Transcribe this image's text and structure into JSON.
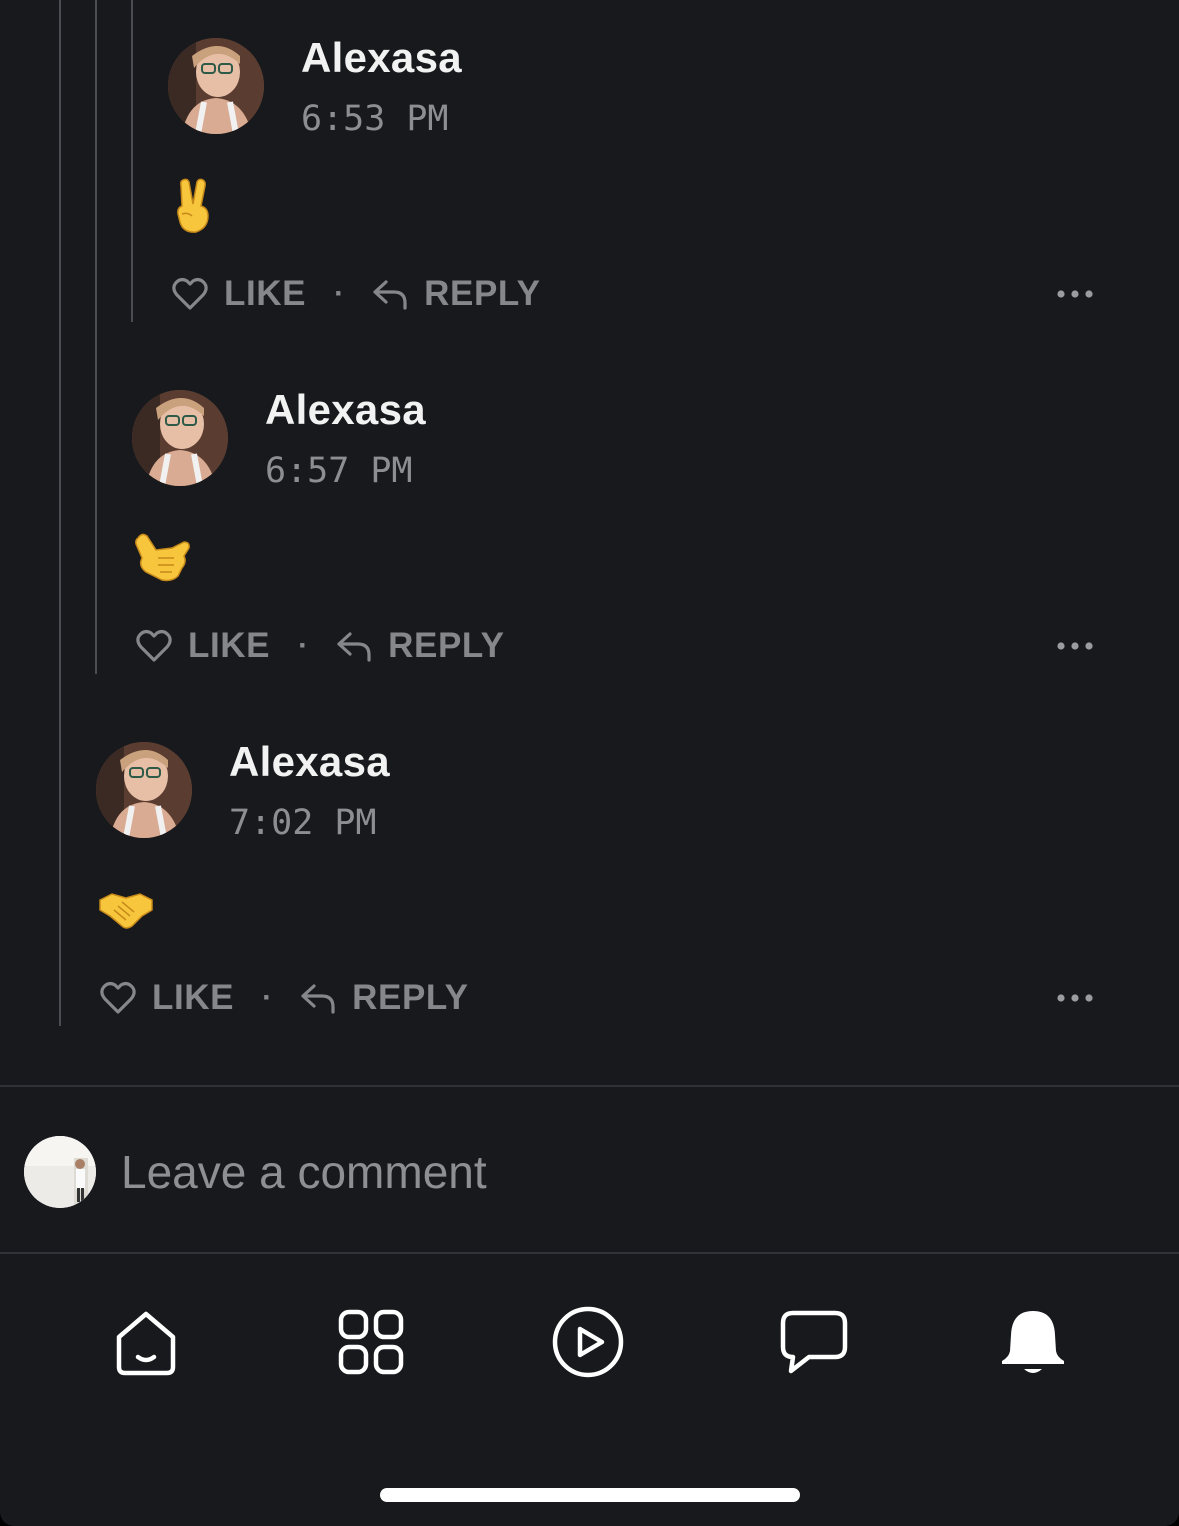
{
  "comments": [
    {
      "author": "Alexasa",
      "time": "6:53 PM",
      "emoji": "✌️",
      "like_label": "LIKE",
      "reply_label": "REPLY",
      "separator": "·"
    },
    {
      "author": "Alexasa",
      "time": "6:57 PM",
      "emoji": "🤙",
      "like_label": "LIKE",
      "reply_label": "REPLY",
      "separator": "·"
    },
    {
      "author": "Alexasa",
      "time": "7:02 PM",
      "emoji": "🤝",
      "like_label": "LIKE",
      "reply_label": "REPLY",
      "separator": "·"
    }
  ],
  "composer": {
    "placeholder": "Leave a comment"
  },
  "tabbar": {
    "items": [
      {
        "icon": "home-icon"
      },
      {
        "icon": "grid-icon"
      },
      {
        "icon": "play-icon"
      },
      {
        "icon": "chat-icon"
      },
      {
        "icon": "bell-icon"
      }
    ]
  },
  "colors": {
    "background": "#17191c",
    "text_primary": "#f2f2f2",
    "text_secondary": "#85878b",
    "thread_line": "#4a4d52",
    "emoji_yellow": "#f7c63c"
  }
}
